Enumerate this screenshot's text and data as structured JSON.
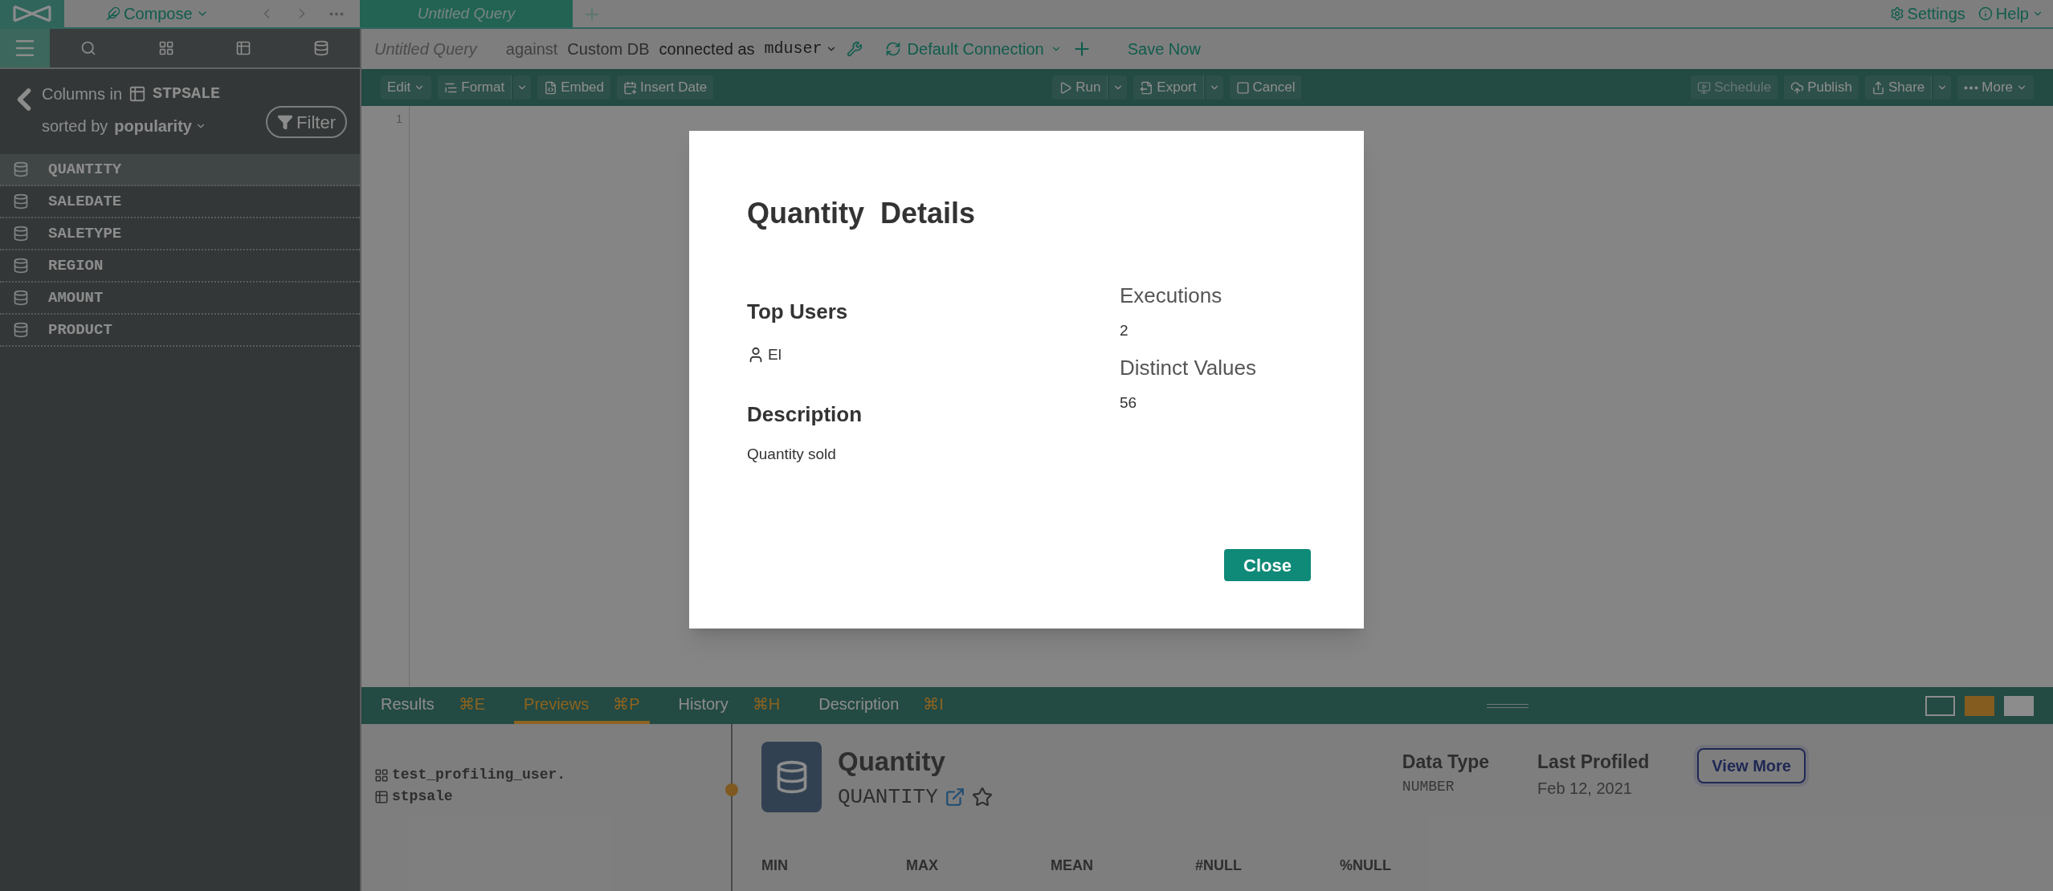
{
  "top_bar": {
    "compose": "Compose",
    "query_tab": "Untitled Query",
    "settings": "Settings",
    "help": "Help"
  },
  "sidebar": {
    "columns_in": "Columns in",
    "table": "STPSALE",
    "sorted_by": "sorted by",
    "sort": "popularity",
    "filter": "Filter",
    "columns": [
      {
        "name": "QUANTITY",
        "selected": true
      },
      {
        "name": "SALEDATE",
        "selected": false
      },
      {
        "name": "SALETYPE",
        "selected": false
      },
      {
        "name": "REGION",
        "selected": false
      },
      {
        "name": "AMOUNT",
        "selected": false
      },
      {
        "name": "PRODUCT",
        "selected": false
      }
    ]
  },
  "query_bar": {
    "title": "Untitled Query",
    "against": "against",
    "db": "Custom DB",
    "connected_as": "connected as",
    "user": "mduser",
    "connection": "Default Connection",
    "save": "Save Now"
  },
  "toolbar": {
    "left": [
      {
        "label": "Edit",
        "caret": true,
        "split": false,
        "disabled": false
      },
      {
        "label": "Format",
        "caret": false,
        "split": true,
        "disabled": false
      },
      {
        "label": "Embed",
        "caret": false,
        "split": false,
        "disabled": false
      },
      {
        "label": "Insert Date",
        "caret": false,
        "split": false,
        "disabled": false
      }
    ],
    "middle": [
      {
        "label": "Run",
        "caret": false,
        "split": true,
        "disabled": false
      },
      {
        "label": "Export",
        "caret": false,
        "split": true,
        "disabled": false
      },
      {
        "label": "Cancel",
        "caret": false,
        "split": false,
        "disabled": false
      }
    ],
    "right": [
      {
        "label": "Schedule",
        "caret": false,
        "split": false,
        "disabled": true
      },
      {
        "label": "Publish",
        "caret": false,
        "split": false,
        "disabled": false
      },
      {
        "label": "Share",
        "caret": false,
        "split": true,
        "disabled": false
      },
      {
        "label": "More",
        "caret": true,
        "split": false,
        "disabled": false
      }
    ]
  },
  "editor": {
    "line_number": "1"
  },
  "bottom_tabs": [
    {
      "label": "Results",
      "shortcut": "⌘E",
      "selected": false
    },
    {
      "label": "Previews",
      "shortcut": "⌘P",
      "selected": true
    },
    {
      "label": "History",
      "shortcut": "⌘H",
      "selected": false
    },
    {
      "label": "Description",
      "shortcut": "⌘I",
      "selected": false
    }
  ],
  "layout_options": [
    {
      "selected": false
    },
    {
      "selected": true
    },
    {
      "selected": false
    }
  ],
  "preview": {
    "schema": "test_profiling_user.",
    "table": "stpsale",
    "title": "Quantity",
    "column": "QUANTITY",
    "data_type_label": "Data Type",
    "data_type": "NUMBER",
    "last_profiled_label": "Last Profiled",
    "last_profiled": "Feb 12, 2021",
    "view_more": "View More",
    "stats": [
      "MIN",
      "MAX",
      "MEAN",
      "#NULL",
      "%NULL"
    ]
  },
  "modal": {
    "title": "Quantity  Details",
    "top_users_label": "Top Users",
    "users": [
      "El"
    ],
    "description_label": "Description",
    "description": "Quantity sold",
    "executions_label": "Executions",
    "executions": "2",
    "distinct_label": "Distinct Values",
    "distinct": "56",
    "close": "Close"
  }
}
